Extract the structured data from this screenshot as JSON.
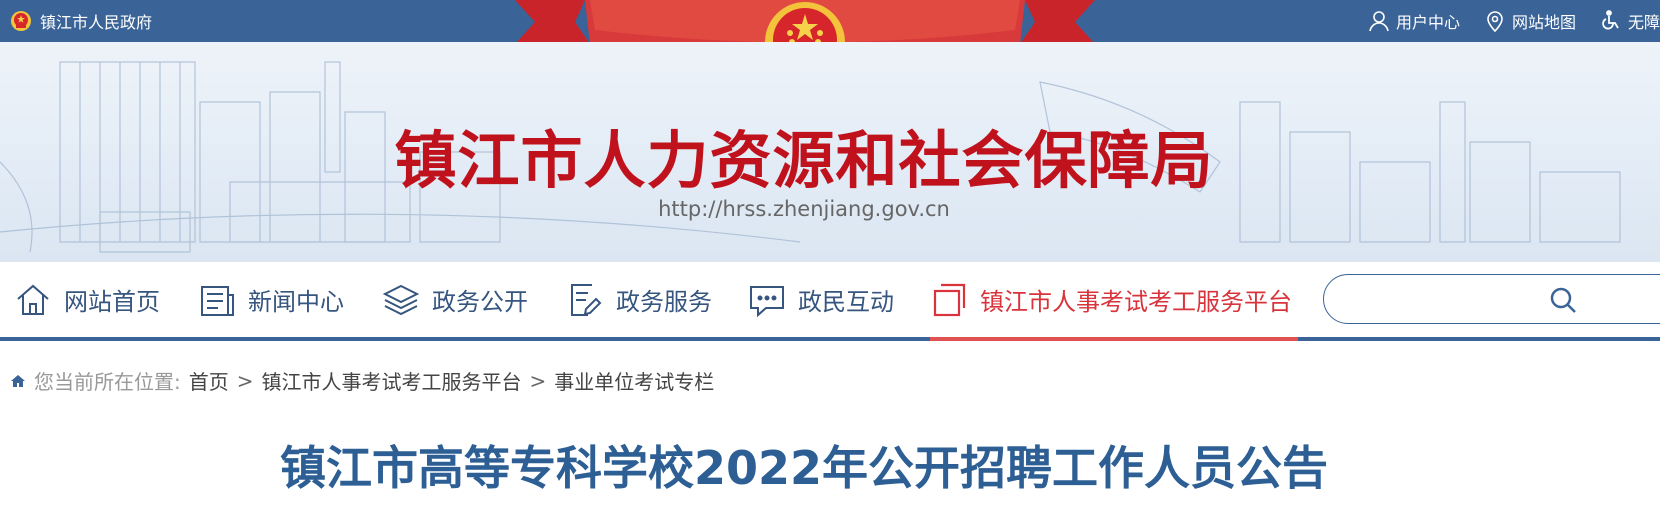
{
  "topbar": {
    "gov_link": "镇江市人民政府",
    "user_center": "用户中心",
    "site_map": "网站地图",
    "accessibility": "无障"
  },
  "banner": {
    "title": "镇江市人力资源和社会保障局",
    "url": "http://hrss.zhenjiang.gov.cn"
  },
  "nav": {
    "items": [
      {
        "label": "网站首页",
        "icon": "home-icon"
      },
      {
        "label": "新闻中心",
        "icon": "news-icon"
      },
      {
        "label": "政务公开",
        "icon": "layers-icon"
      },
      {
        "label": "政务服务",
        "icon": "document-edit-icon"
      },
      {
        "label": "政民互动",
        "icon": "chat-icon"
      },
      {
        "label": "镇江市人事考试考工服务平台",
        "icon": "copy-icon",
        "active": true
      }
    ],
    "search_placeholder": ""
  },
  "breadcrumb": {
    "prefix": "您当前所在位置:",
    "items": [
      "首页",
      "镇江市人事考试考工服务平台",
      "事业单位考试专栏"
    ],
    "separator": ">"
  },
  "article": {
    "title": "镇江市高等专科学校2022年公开招聘工作人员公告"
  },
  "colors": {
    "primary_blue": "#3a6397",
    "title_red": "#c0121c",
    "active_red": "#d9333c",
    "article_blue": "#2d5f95"
  }
}
